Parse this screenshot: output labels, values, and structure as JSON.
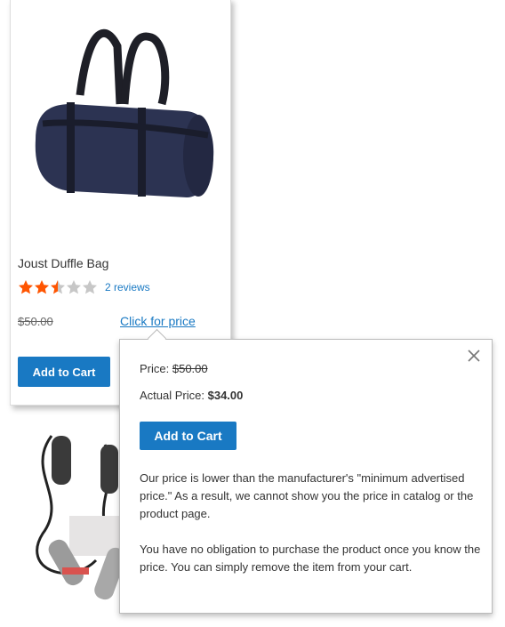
{
  "product": {
    "name": "Joust Duffle Bag",
    "rating_fraction": 0.5,
    "reviews": "2 reviews",
    "old_price": "$50.00",
    "click_for_price": "Click for price",
    "add_to_cart": "Add to Cart"
  },
  "popup": {
    "price_label": "Price:",
    "price_value": "$50.00",
    "actual_label": "Actual Price:",
    "actual_value": "$34.00",
    "add_to_cart": "Add to Cart",
    "message_1": "Our price is lower than the manufacturer's \"minimum advertised price.\" As a result, we cannot show you the price in catalog or the product page.",
    "message_2": "You have no obligation to purchase the product once you know the price. You can simply remove the item from your cart."
  },
  "icons": {
    "close": "close-icon",
    "star": "star-icon"
  },
  "colors": {
    "accent": "#1979c3",
    "star_filled": "#ff5501",
    "star_empty": "#c7c7c7"
  }
}
